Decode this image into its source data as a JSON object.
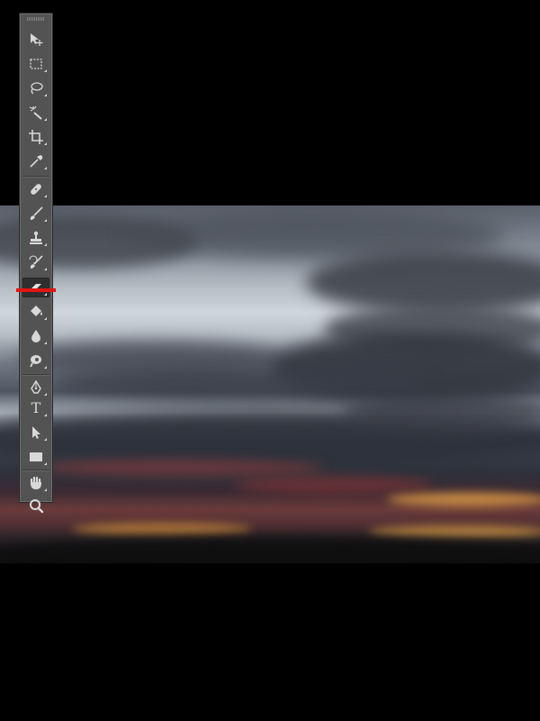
{
  "toolbar": {
    "tools": [
      {
        "name": "move-tool",
        "icon": "move-icon",
        "has_submenu": false
      },
      {
        "name": "marquee-tool",
        "icon": "marquee-icon",
        "has_submenu": true
      },
      {
        "name": "lasso-tool",
        "icon": "lasso-icon",
        "has_submenu": true
      },
      {
        "name": "magic-wand-tool",
        "icon": "magic-wand-icon",
        "has_submenu": true
      },
      {
        "name": "crop-tool",
        "icon": "crop-icon",
        "has_submenu": true
      },
      {
        "name": "eyedropper-tool",
        "icon": "eyedropper-icon",
        "has_submenu": true
      },
      {
        "name": "healing-brush-tool",
        "icon": "bandage-icon",
        "has_submenu": true
      },
      {
        "name": "brush-tool",
        "icon": "brush-icon",
        "has_submenu": true
      },
      {
        "name": "clone-stamp-tool",
        "icon": "stamp-icon",
        "has_submenu": true
      },
      {
        "name": "history-brush-tool",
        "icon": "history-brush-icon",
        "has_submenu": true
      },
      {
        "name": "eraser-tool",
        "icon": "eraser-icon",
        "has_submenu": true,
        "active": true
      },
      {
        "name": "paint-bucket-tool",
        "icon": "paint-bucket-icon",
        "has_submenu": true
      },
      {
        "name": "blur-tool",
        "icon": "drop-icon",
        "has_submenu": true
      },
      {
        "name": "dodge-tool",
        "icon": "dodge-icon",
        "has_submenu": true
      },
      {
        "name": "pen-tool",
        "icon": "pen-icon",
        "has_submenu": true
      },
      {
        "name": "type-tool",
        "icon": "type-icon",
        "label": "T",
        "has_submenu": true
      },
      {
        "name": "path-selection-tool",
        "icon": "arrow-icon",
        "has_submenu": true
      },
      {
        "name": "rectangle-tool",
        "icon": "rectangle-icon",
        "has_submenu": true
      },
      {
        "name": "hand-tool",
        "icon": "hand-icon",
        "has_submenu": true
      },
      {
        "name": "zoom-tool",
        "icon": "magnifier-icon",
        "has_submenu": false
      }
    ]
  },
  "highlight": {
    "color": "#e31414",
    "target": "eraser-tool"
  },
  "colors": {
    "toolbar_bg": "#535353",
    "canvas_bg": "#000000",
    "icon": "#d8d8d8"
  }
}
